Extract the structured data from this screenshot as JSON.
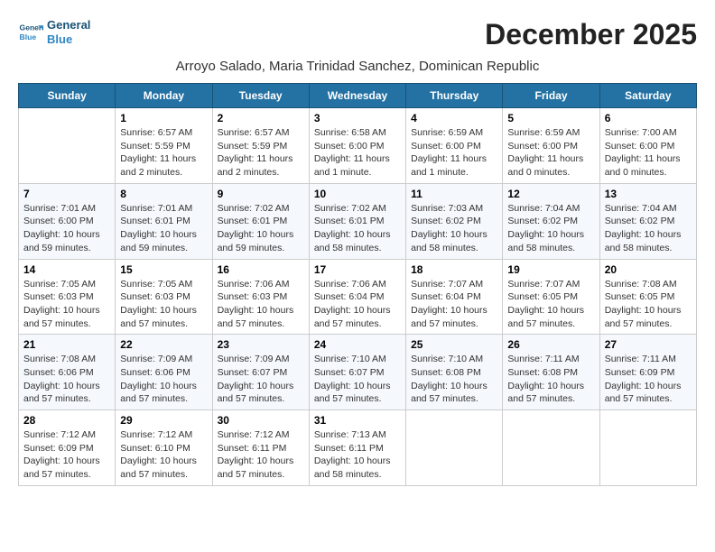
{
  "logo": {
    "general": "General",
    "blue": "Blue"
  },
  "title": "December 2025",
  "subtitle": "Arroyo Salado, Maria Trinidad Sanchez, Dominican Republic",
  "days_of_week": [
    "Sunday",
    "Monday",
    "Tuesday",
    "Wednesday",
    "Thursday",
    "Friday",
    "Saturday"
  ],
  "weeks": [
    [
      {
        "day": "",
        "info": ""
      },
      {
        "day": "1",
        "info": "Sunrise: 6:57 AM\nSunset: 5:59 PM\nDaylight: 11 hours\nand 2 minutes."
      },
      {
        "day": "2",
        "info": "Sunrise: 6:57 AM\nSunset: 5:59 PM\nDaylight: 11 hours\nand 2 minutes."
      },
      {
        "day": "3",
        "info": "Sunrise: 6:58 AM\nSunset: 6:00 PM\nDaylight: 11 hours\nand 1 minute."
      },
      {
        "day": "4",
        "info": "Sunrise: 6:59 AM\nSunset: 6:00 PM\nDaylight: 11 hours\nand 1 minute."
      },
      {
        "day": "5",
        "info": "Sunrise: 6:59 AM\nSunset: 6:00 PM\nDaylight: 11 hours\nand 0 minutes."
      },
      {
        "day": "6",
        "info": "Sunrise: 7:00 AM\nSunset: 6:00 PM\nDaylight: 11 hours\nand 0 minutes."
      }
    ],
    [
      {
        "day": "7",
        "info": "Sunrise: 7:01 AM\nSunset: 6:00 PM\nDaylight: 10 hours\nand 59 minutes."
      },
      {
        "day": "8",
        "info": "Sunrise: 7:01 AM\nSunset: 6:01 PM\nDaylight: 10 hours\nand 59 minutes."
      },
      {
        "day": "9",
        "info": "Sunrise: 7:02 AM\nSunset: 6:01 PM\nDaylight: 10 hours\nand 59 minutes."
      },
      {
        "day": "10",
        "info": "Sunrise: 7:02 AM\nSunset: 6:01 PM\nDaylight: 10 hours\nand 58 minutes."
      },
      {
        "day": "11",
        "info": "Sunrise: 7:03 AM\nSunset: 6:02 PM\nDaylight: 10 hours\nand 58 minutes."
      },
      {
        "day": "12",
        "info": "Sunrise: 7:04 AM\nSunset: 6:02 PM\nDaylight: 10 hours\nand 58 minutes."
      },
      {
        "day": "13",
        "info": "Sunrise: 7:04 AM\nSunset: 6:02 PM\nDaylight: 10 hours\nand 58 minutes."
      }
    ],
    [
      {
        "day": "14",
        "info": "Sunrise: 7:05 AM\nSunset: 6:03 PM\nDaylight: 10 hours\nand 57 minutes."
      },
      {
        "day": "15",
        "info": "Sunrise: 7:05 AM\nSunset: 6:03 PM\nDaylight: 10 hours\nand 57 minutes."
      },
      {
        "day": "16",
        "info": "Sunrise: 7:06 AM\nSunset: 6:03 PM\nDaylight: 10 hours\nand 57 minutes."
      },
      {
        "day": "17",
        "info": "Sunrise: 7:06 AM\nSunset: 6:04 PM\nDaylight: 10 hours\nand 57 minutes."
      },
      {
        "day": "18",
        "info": "Sunrise: 7:07 AM\nSunset: 6:04 PM\nDaylight: 10 hours\nand 57 minutes."
      },
      {
        "day": "19",
        "info": "Sunrise: 7:07 AM\nSunset: 6:05 PM\nDaylight: 10 hours\nand 57 minutes."
      },
      {
        "day": "20",
        "info": "Sunrise: 7:08 AM\nSunset: 6:05 PM\nDaylight: 10 hours\nand 57 minutes."
      }
    ],
    [
      {
        "day": "21",
        "info": "Sunrise: 7:08 AM\nSunset: 6:06 PM\nDaylight: 10 hours\nand 57 minutes."
      },
      {
        "day": "22",
        "info": "Sunrise: 7:09 AM\nSunset: 6:06 PM\nDaylight: 10 hours\nand 57 minutes."
      },
      {
        "day": "23",
        "info": "Sunrise: 7:09 AM\nSunset: 6:07 PM\nDaylight: 10 hours\nand 57 minutes."
      },
      {
        "day": "24",
        "info": "Sunrise: 7:10 AM\nSunset: 6:07 PM\nDaylight: 10 hours\nand 57 minutes."
      },
      {
        "day": "25",
        "info": "Sunrise: 7:10 AM\nSunset: 6:08 PM\nDaylight: 10 hours\nand 57 minutes."
      },
      {
        "day": "26",
        "info": "Sunrise: 7:11 AM\nSunset: 6:08 PM\nDaylight: 10 hours\nand 57 minutes."
      },
      {
        "day": "27",
        "info": "Sunrise: 7:11 AM\nSunset: 6:09 PM\nDaylight: 10 hours\nand 57 minutes."
      }
    ],
    [
      {
        "day": "28",
        "info": "Sunrise: 7:12 AM\nSunset: 6:09 PM\nDaylight: 10 hours\nand 57 minutes."
      },
      {
        "day": "29",
        "info": "Sunrise: 7:12 AM\nSunset: 6:10 PM\nDaylight: 10 hours\nand 57 minutes."
      },
      {
        "day": "30",
        "info": "Sunrise: 7:12 AM\nSunset: 6:11 PM\nDaylight: 10 hours\nand 57 minutes."
      },
      {
        "day": "31",
        "info": "Sunrise: 7:13 AM\nSunset: 6:11 PM\nDaylight: 10 hours\nand 58 minutes."
      },
      {
        "day": "",
        "info": ""
      },
      {
        "day": "",
        "info": ""
      },
      {
        "day": "",
        "info": ""
      }
    ]
  ]
}
